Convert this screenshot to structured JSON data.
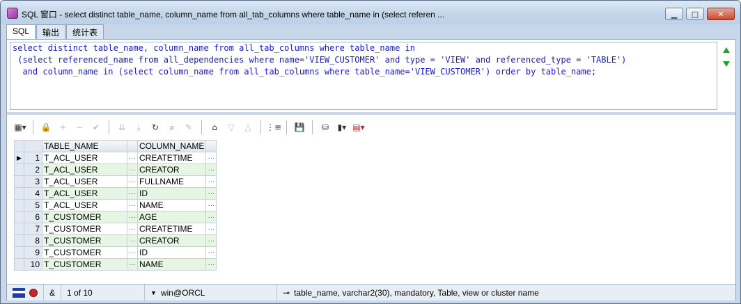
{
  "window": {
    "title": "SQL 窗口 - select distinct table_name, column_name from all_tab_columns where table_name in (select referen ...",
    "controls": {
      "minimize": "▁",
      "maximize": "□",
      "close": "✕"
    }
  },
  "tabs": [
    {
      "label": "SQL",
      "active": true
    },
    {
      "label": "输出",
      "active": false
    },
    {
      "label": "统计表",
      "active": false
    }
  ],
  "sql": {
    "lines": [
      "select distinct table_name, column_name from all_tab_columns where table_name in",
      " (select referenced_name from all_dependencies where name='VIEW_CUSTOMER' and type = 'VIEW' and referenced_type = 'TABLE')",
      "  and column_name in (select column_name from all_tab_columns where table_name='VIEW_CUSTOMER') order by table_name;"
    ]
  },
  "toolbar": {
    "icons": [
      "grid-menu-icon",
      "lock-icon",
      "add-row-icon",
      "delete-row-icon",
      "post-icon",
      "fetch-next-icon",
      "fetch-all-icon",
      "refresh-icon",
      "find-icon",
      "clear-icon",
      "query-icon",
      "filter-down-icon",
      "filter-up-icon",
      "tree-icon",
      "save-icon",
      "export-icon",
      "chart-icon",
      "table-export-icon"
    ]
  },
  "grid": {
    "columns": [
      "TABLE_NAME",
      "COLUMN_NAME"
    ],
    "rows": [
      {
        "n": "1",
        "table_name": "T_ACL_USER",
        "column_name": "CREATETIME"
      },
      {
        "n": "2",
        "table_name": "T_ACL_USER",
        "column_name": "CREATOR"
      },
      {
        "n": "3",
        "table_name": "T_ACL_USER",
        "column_name": "FULLNAME"
      },
      {
        "n": "4",
        "table_name": "T_ACL_USER",
        "column_name": "ID"
      },
      {
        "n": "5",
        "table_name": "T_ACL_USER",
        "column_name": "NAME"
      },
      {
        "n": "6",
        "table_name": "T_CUSTOMER",
        "column_name": "AGE"
      },
      {
        "n": "7",
        "table_name": "T_CUSTOMER",
        "column_name": "CREATETIME"
      },
      {
        "n": "8",
        "table_name": "T_CUSTOMER",
        "column_name": "CREATOR"
      },
      {
        "n": "9",
        "table_name": "T_CUSTOMER",
        "column_name": "ID"
      },
      {
        "n": "10",
        "table_name": "T_CUSTOMER",
        "column_name": "NAME"
      }
    ],
    "ellipsis": "···"
  },
  "status": {
    "ampersand": "&",
    "record_count": "1 of 10",
    "connection": "win@ORCL",
    "column_info": "table_name, varchar2(30), mandatory, Table, view or cluster name"
  }
}
